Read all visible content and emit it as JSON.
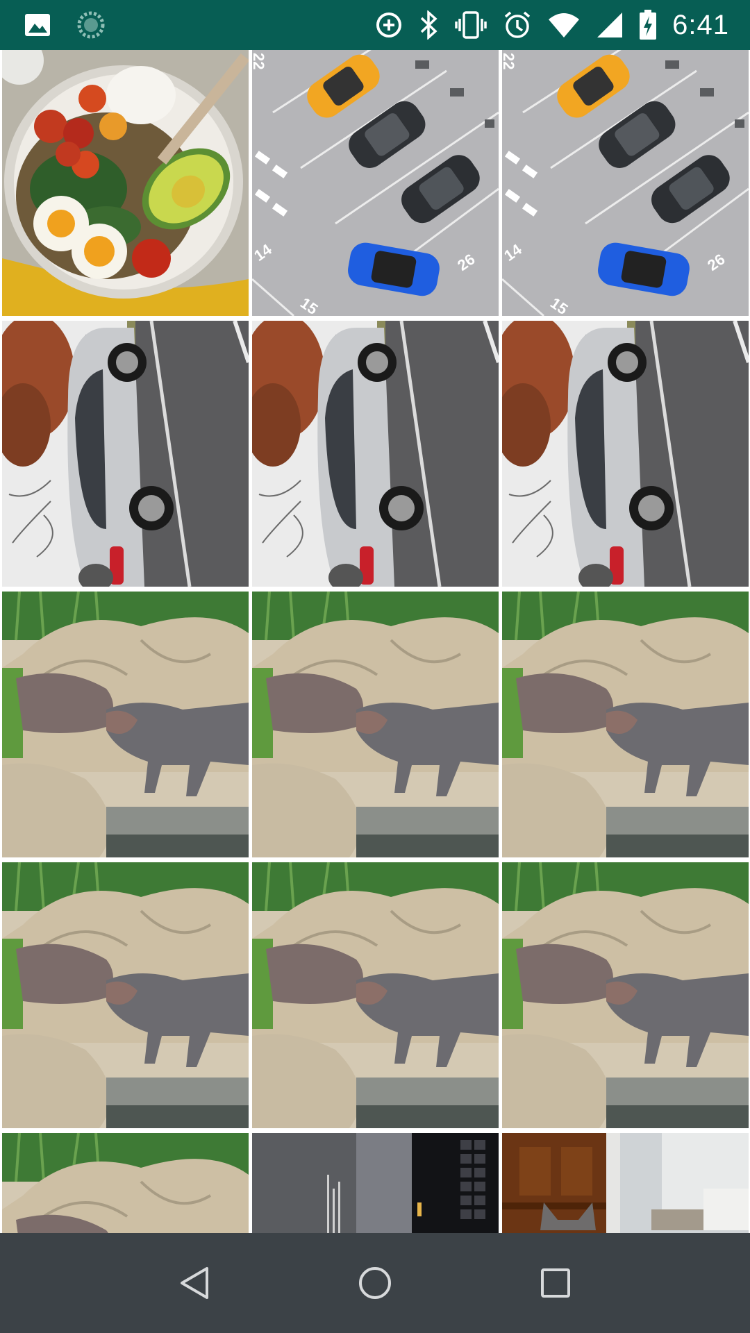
{
  "status_bar": {
    "time": "6:41",
    "background_color": "#075e54",
    "left_icons": [
      "gallery-notification-icon",
      "loading-spinner-icon"
    ],
    "right_icons": [
      "data-saver-icon",
      "bluetooth-icon",
      "vibrate-icon",
      "alarm-icon",
      "wifi-icon",
      "cellular-signal-icon",
      "battery-charging-icon"
    ]
  },
  "gallery": {
    "columns": 3,
    "rows": [
      [
        "food-bowl",
        "parking-lot",
        "parking-lot"
      ],
      [
        "silver-car",
        "silver-car",
        "silver-car"
      ],
      [
        "hippos",
        "hippos",
        "hippos"
      ],
      [
        "hippos",
        "hippos",
        "hippos"
      ],
      [
        "hippos",
        "screen-photo",
        "cat-cabinet"
      ]
    ],
    "parking_numbers": [
      "22",
      "14",
      "15",
      "26"
    ]
  },
  "nav_bar": {
    "background_color": "#3c4247",
    "buttons": [
      "back-icon",
      "home-icon",
      "recents-icon"
    ]
  }
}
